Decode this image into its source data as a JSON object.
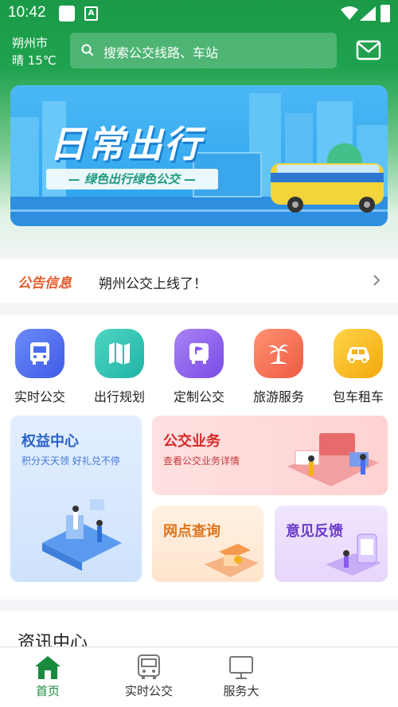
{
  "status": {
    "time": "10:42"
  },
  "header": {
    "city": "朔州市",
    "weather": "晴 15℃",
    "search_placeholder": "搜索公交线路、车站"
  },
  "banner": {
    "title": "日常出行",
    "subtitle": "— 绿色出行绿色公交 —"
  },
  "notice": {
    "tag": "公告信息",
    "text": "朔州公交上线了！"
  },
  "services": [
    {
      "label": "实时公交",
      "icon": "bus-icon",
      "color": "#4a6cf0"
    },
    {
      "label": "出行规划",
      "icon": "map-icon",
      "color": "#27c2b0"
    },
    {
      "label": "定制公交",
      "icon": "custom-bus-icon",
      "color": "#8a5cf0"
    },
    {
      "label": "旅游服务",
      "icon": "palm-tree-icon",
      "color": "#f06a4a"
    },
    {
      "label": "包车租车",
      "icon": "car-icon",
      "color": "#f5b21c"
    }
  ],
  "cards": {
    "rights": {
      "title": "权益中心",
      "subtitle": "积分天天领 好礼兑不停"
    },
    "business": {
      "title": "公交业务",
      "subtitle": "查看公交业务详情"
    },
    "outlets": {
      "title": "网点查询"
    },
    "feedback": {
      "title": "意见反馈"
    }
  },
  "news": {
    "title": "资讯中心"
  },
  "tabs": [
    {
      "label": "首页",
      "icon": "home-icon",
      "active": true
    },
    {
      "label": "实时公交",
      "icon": "bus-icon",
      "active": false
    },
    {
      "label": "服务大",
      "icon": "monitor-icon",
      "active": false
    }
  ],
  "colors": {
    "primary": "#1a9a47",
    "accent": "#e85b2c"
  }
}
